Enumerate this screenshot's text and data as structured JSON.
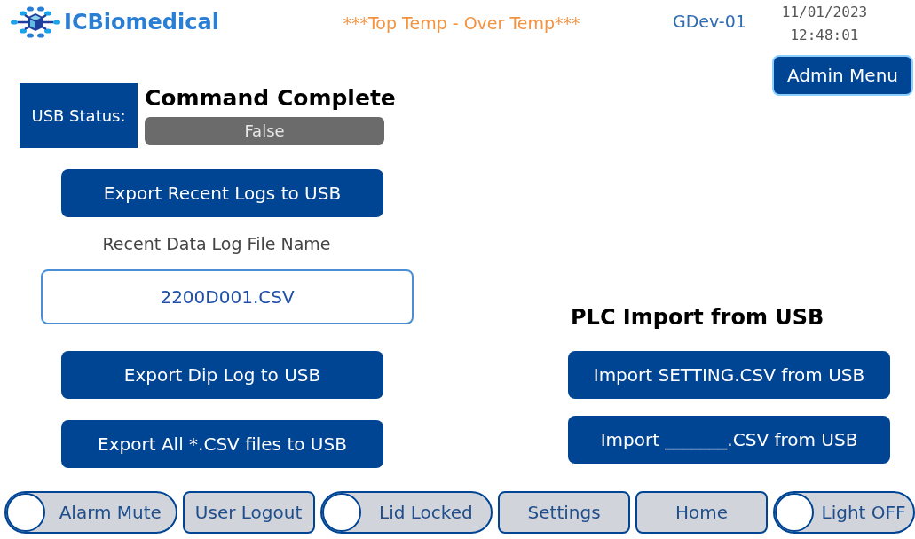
{
  "header": {
    "brand": "ICBiomedical",
    "alarm": "***Top Temp - Over Temp***",
    "device": "GDev-01",
    "date": "11/01/2023",
    "time": "12:48:01"
  },
  "admin_button": "Admin Menu",
  "usb_status": {
    "label": "USB Status:",
    "message": "Command Complete",
    "value": "False",
    "active": false
  },
  "left_actions": [
    {
      "kind": "button",
      "label": "Export Recent Logs to USB"
    },
    {
      "kind": "caption",
      "label": "Recent Data Log File Name"
    },
    {
      "kind": "field",
      "label": "2200D001.CSV"
    },
    {
      "kind": "button",
      "label": "Export Dip Log to USB"
    },
    {
      "kind": "button",
      "label": "Export All *.CSV files to USB"
    }
  ],
  "import_panel": {
    "title": "PLC Import from USB",
    "buttons": [
      "Import SETTING.CSV from USB",
      "Import _______.CSV from USB"
    ]
  },
  "bottom_bar": [
    {
      "kind": "toggle",
      "label": "Alarm Mute",
      "on": false
    },
    {
      "kind": "button",
      "label": "User Logout"
    },
    {
      "kind": "toggle",
      "label": "Lid Locked",
      "on": false
    },
    {
      "kind": "button",
      "label": "Settings"
    },
    {
      "kind": "button",
      "label": "Home"
    },
    {
      "kind": "toggle",
      "label": "Light OFF",
      "on": false
    }
  ]
}
